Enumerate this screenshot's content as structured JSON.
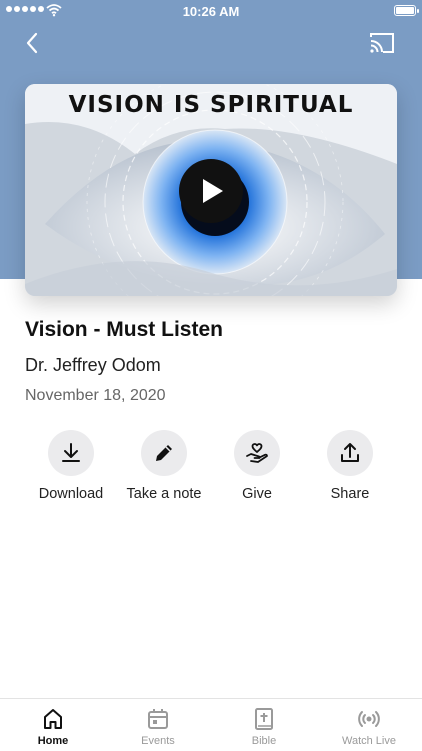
{
  "status_bar": {
    "time": "10:26 AM"
  },
  "media": {
    "banner_text": "VISION IS SPIRITUAL",
    "title": "Vision - Must Listen",
    "speaker": "Dr. Jeffrey Odom",
    "date": "November 18, 2020"
  },
  "actions": [
    {
      "label": "Download",
      "icon": "download-icon"
    },
    {
      "label": "Take a note",
      "icon": "pencil-icon"
    },
    {
      "label": "Give",
      "icon": "give-hand-heart-icon"
    },
    {
      "label": "Share",
      "icon": "share-icon"
    }
  ],
  "tabs": [
    {
      "label": "Home",
      "icon": "home-icon",
      "active": true
    },
    {
      "label": "Events",
      "icon": "calendar-icon",
      "active": false
    },
    {
      "label": "Bible",
      "icon": "bible-icon",
      "active": false
    },
    {
      "label": "Watch Live",
      "icon": "broadcast-icon",
      "active": false
    }
  ],
  "colors": {
    "header_bg": "#7b9cc4",
    "action_circle": "#ebebed",
    "tab_inactive": "#9a9a9a",
    "tab_active": "#111111",
    "iris_blue": "#1e6fd9"
  }
}
